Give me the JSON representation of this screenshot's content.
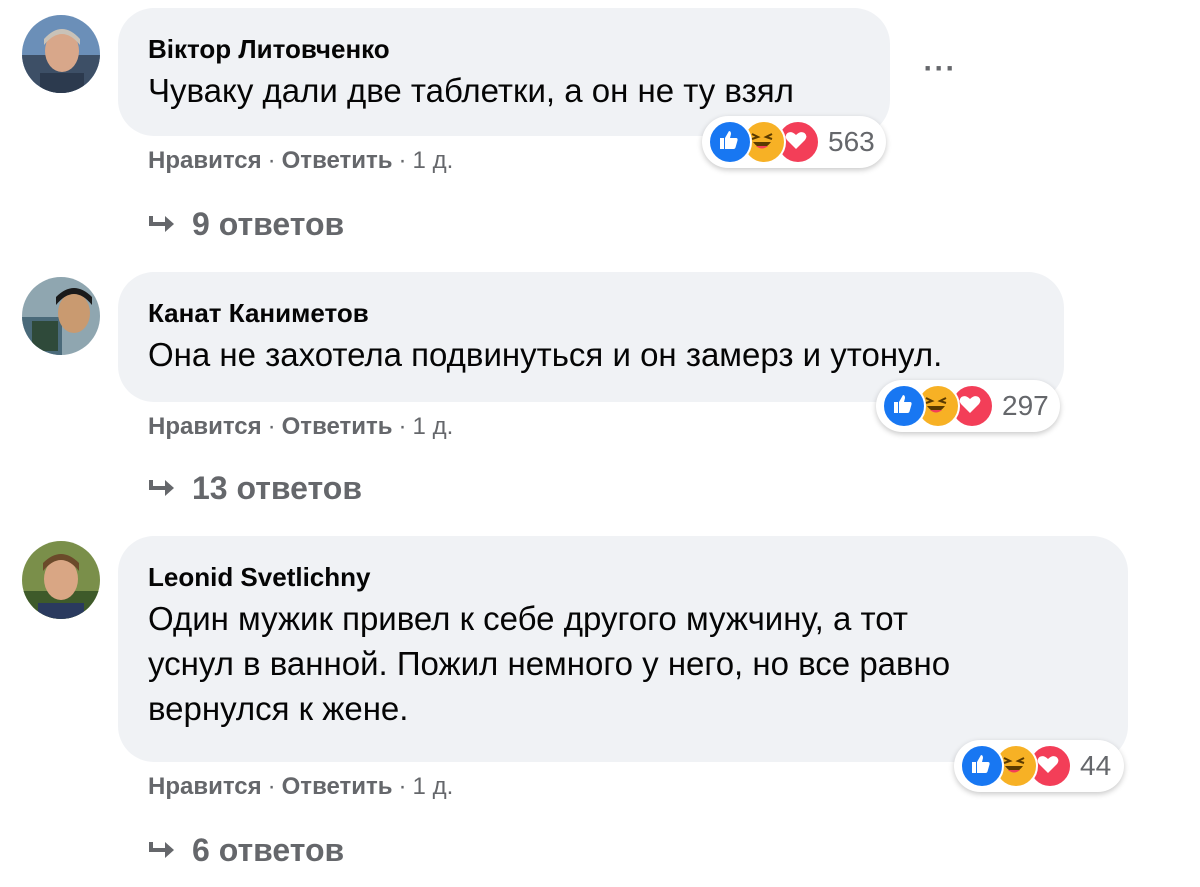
{
  "comments": [
    {
      "author": "Віктор Литовченко",
      "text": "Чуваку дали две таблетки, а он не ту взял",
      "reaction_count": "563",
      "like_label": "Нравится",
      "reply_label": "Ответить",
      "time": "1 д.",
      "replies_label": "9 ответов",
      "more_label": "···"
    },
    {
      "author": "Канат Каниметов",
      "text": "Она не захотела подвинуться и он замерз и утонул.",
      "reaction_count": "297",
      "like_label": "Нравится",
      "reply_label": "Ответить",
      "time": "1 д.",
      "replies_label": "13 ответов"
    },
    {
      "author": "Leonid Svetlichny",
      "text_lines": [
        "Один мужик привел к себе другого мужчину, а тот",
        "уснул в ванной. Пожил немного у него, но все равно",
        "вернулся к жене."
      ],
      "reaction_count": "44",
      "like_label": "Нравится",
      "reply_label": "Ответить",
      "time": "1 д.",
      "replies_label": "6 ответов"
    }
  ],
  "separator": "·",
  "reaction_icons": [
    "like-icon",
    "haha-icon",
    "love-icon"
  ],
  "colors": {
    "bubble_bg": "#f0f2f5",
    "secondary_text": "#65676b",
    "like_blue": "#1877f2",
    "haha_yellow": "#f7b125",
    "love_red": "#f33e58"
  }
}
